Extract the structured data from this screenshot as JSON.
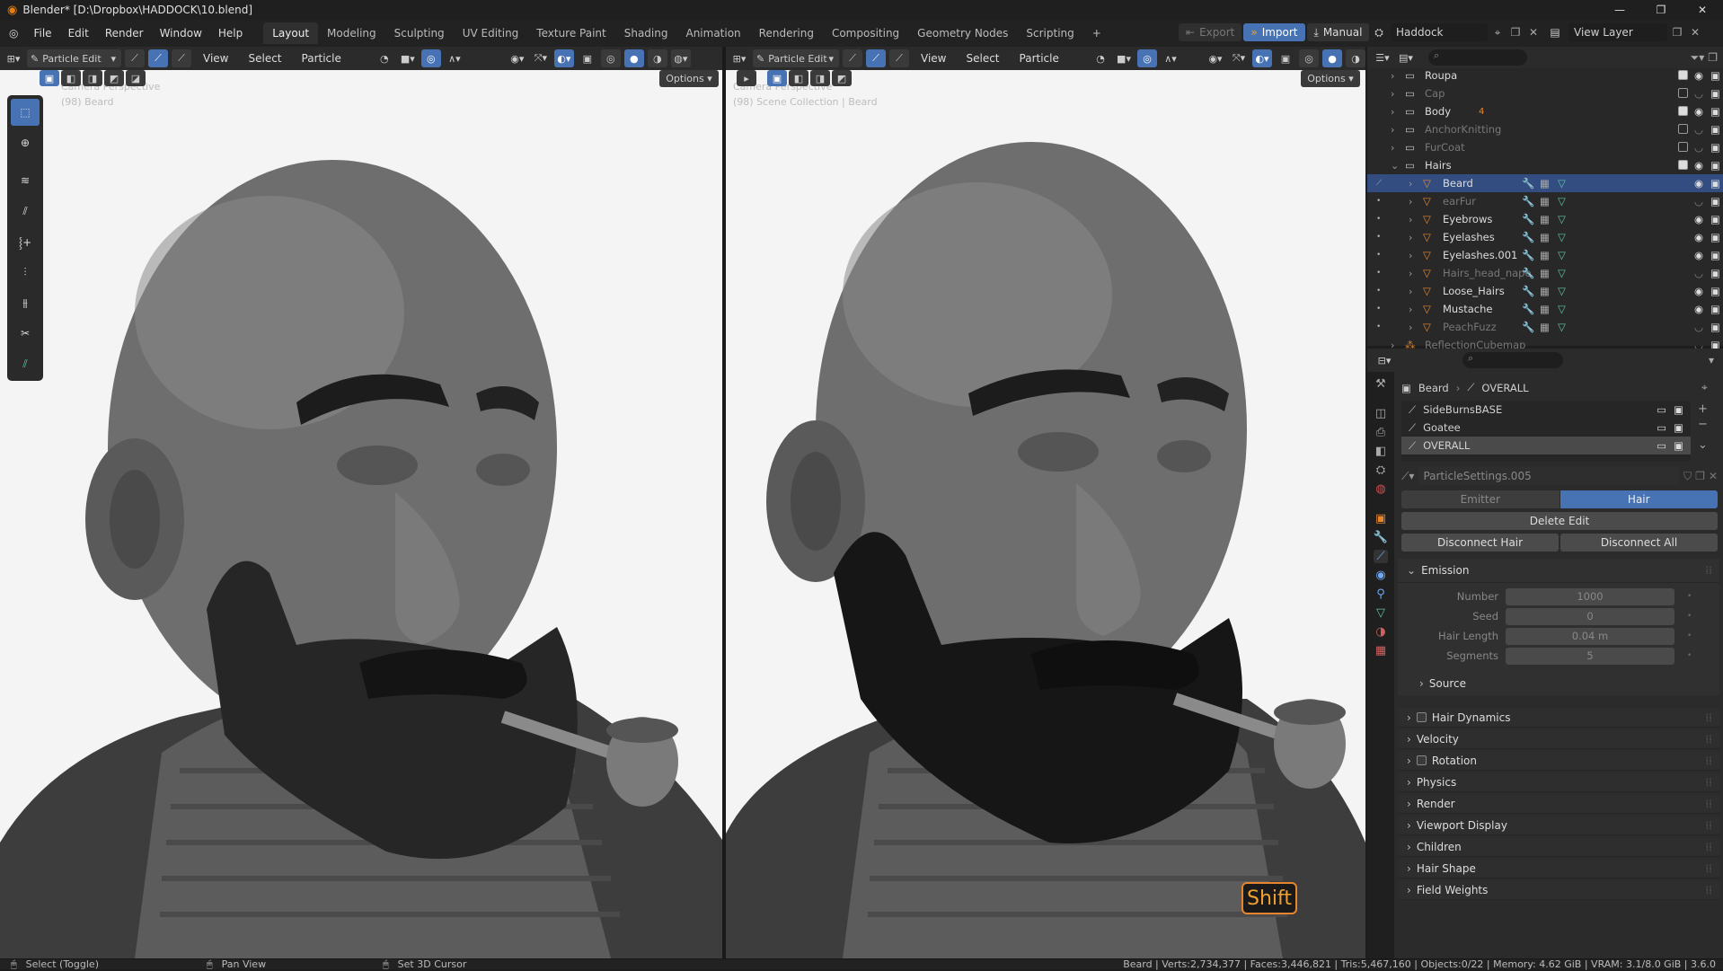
{
  "window": {
    "title": "Blender* [D:\\Dropbox\\HADDOCK\\10.blend]",
    "min": "—",
    "max": "❐",
    "close": "✕"
  },
  "menubar": {
    "menus": [
      "File",
      "Edit",
      "Render",
      "Window",
      "Help"
    ],
    "workspaces": [
      "Layout",
      "Modeling",
      "Sculpting",
      "UV Editing",
      "Texture Paint",
      "Shading",
      "Animation",
      "Rendering",
      "Compositing",
      "Geometry Nodes",
      "Scripting"
    ],
    "add_workspace": "+",
    "export": "Export",
    "import": "Import",
    "manual": "Manual",
    "scene": "Haddock",
    "view_layer": "View Layer"
  },
  "viewport_left": {
    "mode": "Particle Edit",
    "menus": [
      "View",
      "Select",
      "Particle"
    ],
    "options": "Options",
    "overlay_line1": "Camera Perspective",
    "overlay_line2": "(98) Beard"
  },
  "viewport_right": {
    "mode": "Particle Edit",
    "menus": [
      "View",
      "Select",
      "Particle"
    ],
    "options": "Options",
    "overlay_line1": "Camera Perspective",
    "overlay_line2": "(98) Scene Collection | Beard",
    "key_hint": "Shift"
  },
  "outliner": {
    "rows": [
      {
        "label": "Roupa",
        "kind": "collection",
        "depth": 1,
        "checked": true
      },
      {
        "label": "Cap",
        "kind": "collection",
        "depth": 1,
        "checked": false,
        "dim": true
      },
      {
        "label": "Body",
        "kind": "collection",
        "depth": 1,
        "checked": true,
        "badge": "4"
      },
      {
        "label": "AnchorKnitting",
        "kind": "collection",
        "depth": 1,
        "checked": false,
        "dim": true
      },
      {
        "label": "FurCoat",
        "kind": "collection",
        "depth": 1,
        "checked": false,
        "dim": true
      },
      {
        "label": "Hairs",
        "kind": "collection",
        "depth": 1,
        "checked": true,
        "expanded": true
      },
      {
        "label": "Beard",
        "kind": "object",
        "depth": 2,
        "selected": true
      },
      {
        "label": "earFur",
        "kind": "object",
        "depth": 2,
        "dim": true
      },
      {
        "label": "Eyebrows",
        "kind": "object",
        "depth": 2
      },
      {
        "label": "Eyelashes",
        "kind": "object",
        "depth": 2
      },
      {
        "label": "Eyelashes.001",
        "kind": "object",
        "depth": 2
      },
      {
        "label": "Hairs_head_nape",
        "kind": "object",
        "depth": 2,
        "dim": true
      },
      {
        "label": "Loose_Hairs",
        "kind": "object",
        "depth": 2
      },
      {
        "label": "Mustache",
        "kind": "object",
        "depth": 2
      },
      {
        "label": "PeachFuzz",
        "kind": "object",
        "depth": 2,
        "dim": true
      },
      {
        "label": "ReflectionCubemap",
        "kind": "probe",
        "depth": 1,
        "dim": true
      }
    ]
  },
  "properties": {
    "breadcrumb_object": "Beard",
    "breadcrumb_system": "OVERALL",
    "systems": [
      "SideBurnsBASE",
      "Goatee",
      "OVERALL"
    ],
    "settings_name": "ParticleSettings.005",
    "emitter_tab": "Emitter",
    "hair_tab": "Hair",
    "delete_edit": "Delete Edit",
    "disconnect_hair": "Disconnect Hair",
    "disconnect_all": "Disconnect All",
    "emission_label": "Emission",
    "emission_fields": [
      {
        "label": "Number",
        "value": "1000"
      },
      {
        "label": "Seed",
        "value": "0"
      },
      {
        "label": "Hair Length",
        "value": "0.04 m"
      },
      {
        "label": "Segments",
        "value": "5"
      }
    ],
    "source_label": "Source",
    "panels": [
      "Hair Dynamics",
      "Velocity",
      "Rotation",
      "Physics",
      "Render",
      "Viewport Display",
      "Children",
      "Hair Shape",
      "Field Weights"
    ]
  },
  "statusbar": {
    "select": "Select (Toggle)",
    "pan": "Pan View",
    "cursor": "Set 3D Cursor",
    "stats": "Beard | Verts:2,734,377 | Faces:3,446,821 | Tris:5,467,160 | Objects:0/22 | Memory: 4.62 GiB | VRAM: 3.1/8.0 GiB | 3.6.0"
  },
  "colors": {
    "accent": "#4772b3",
    "selected_row": "#334d80",
    "object_orange": "#e5862c",
    "modifier_blue": "#6fa8f0",
    "mesh_green": "#5dc4a4"
  }
}
